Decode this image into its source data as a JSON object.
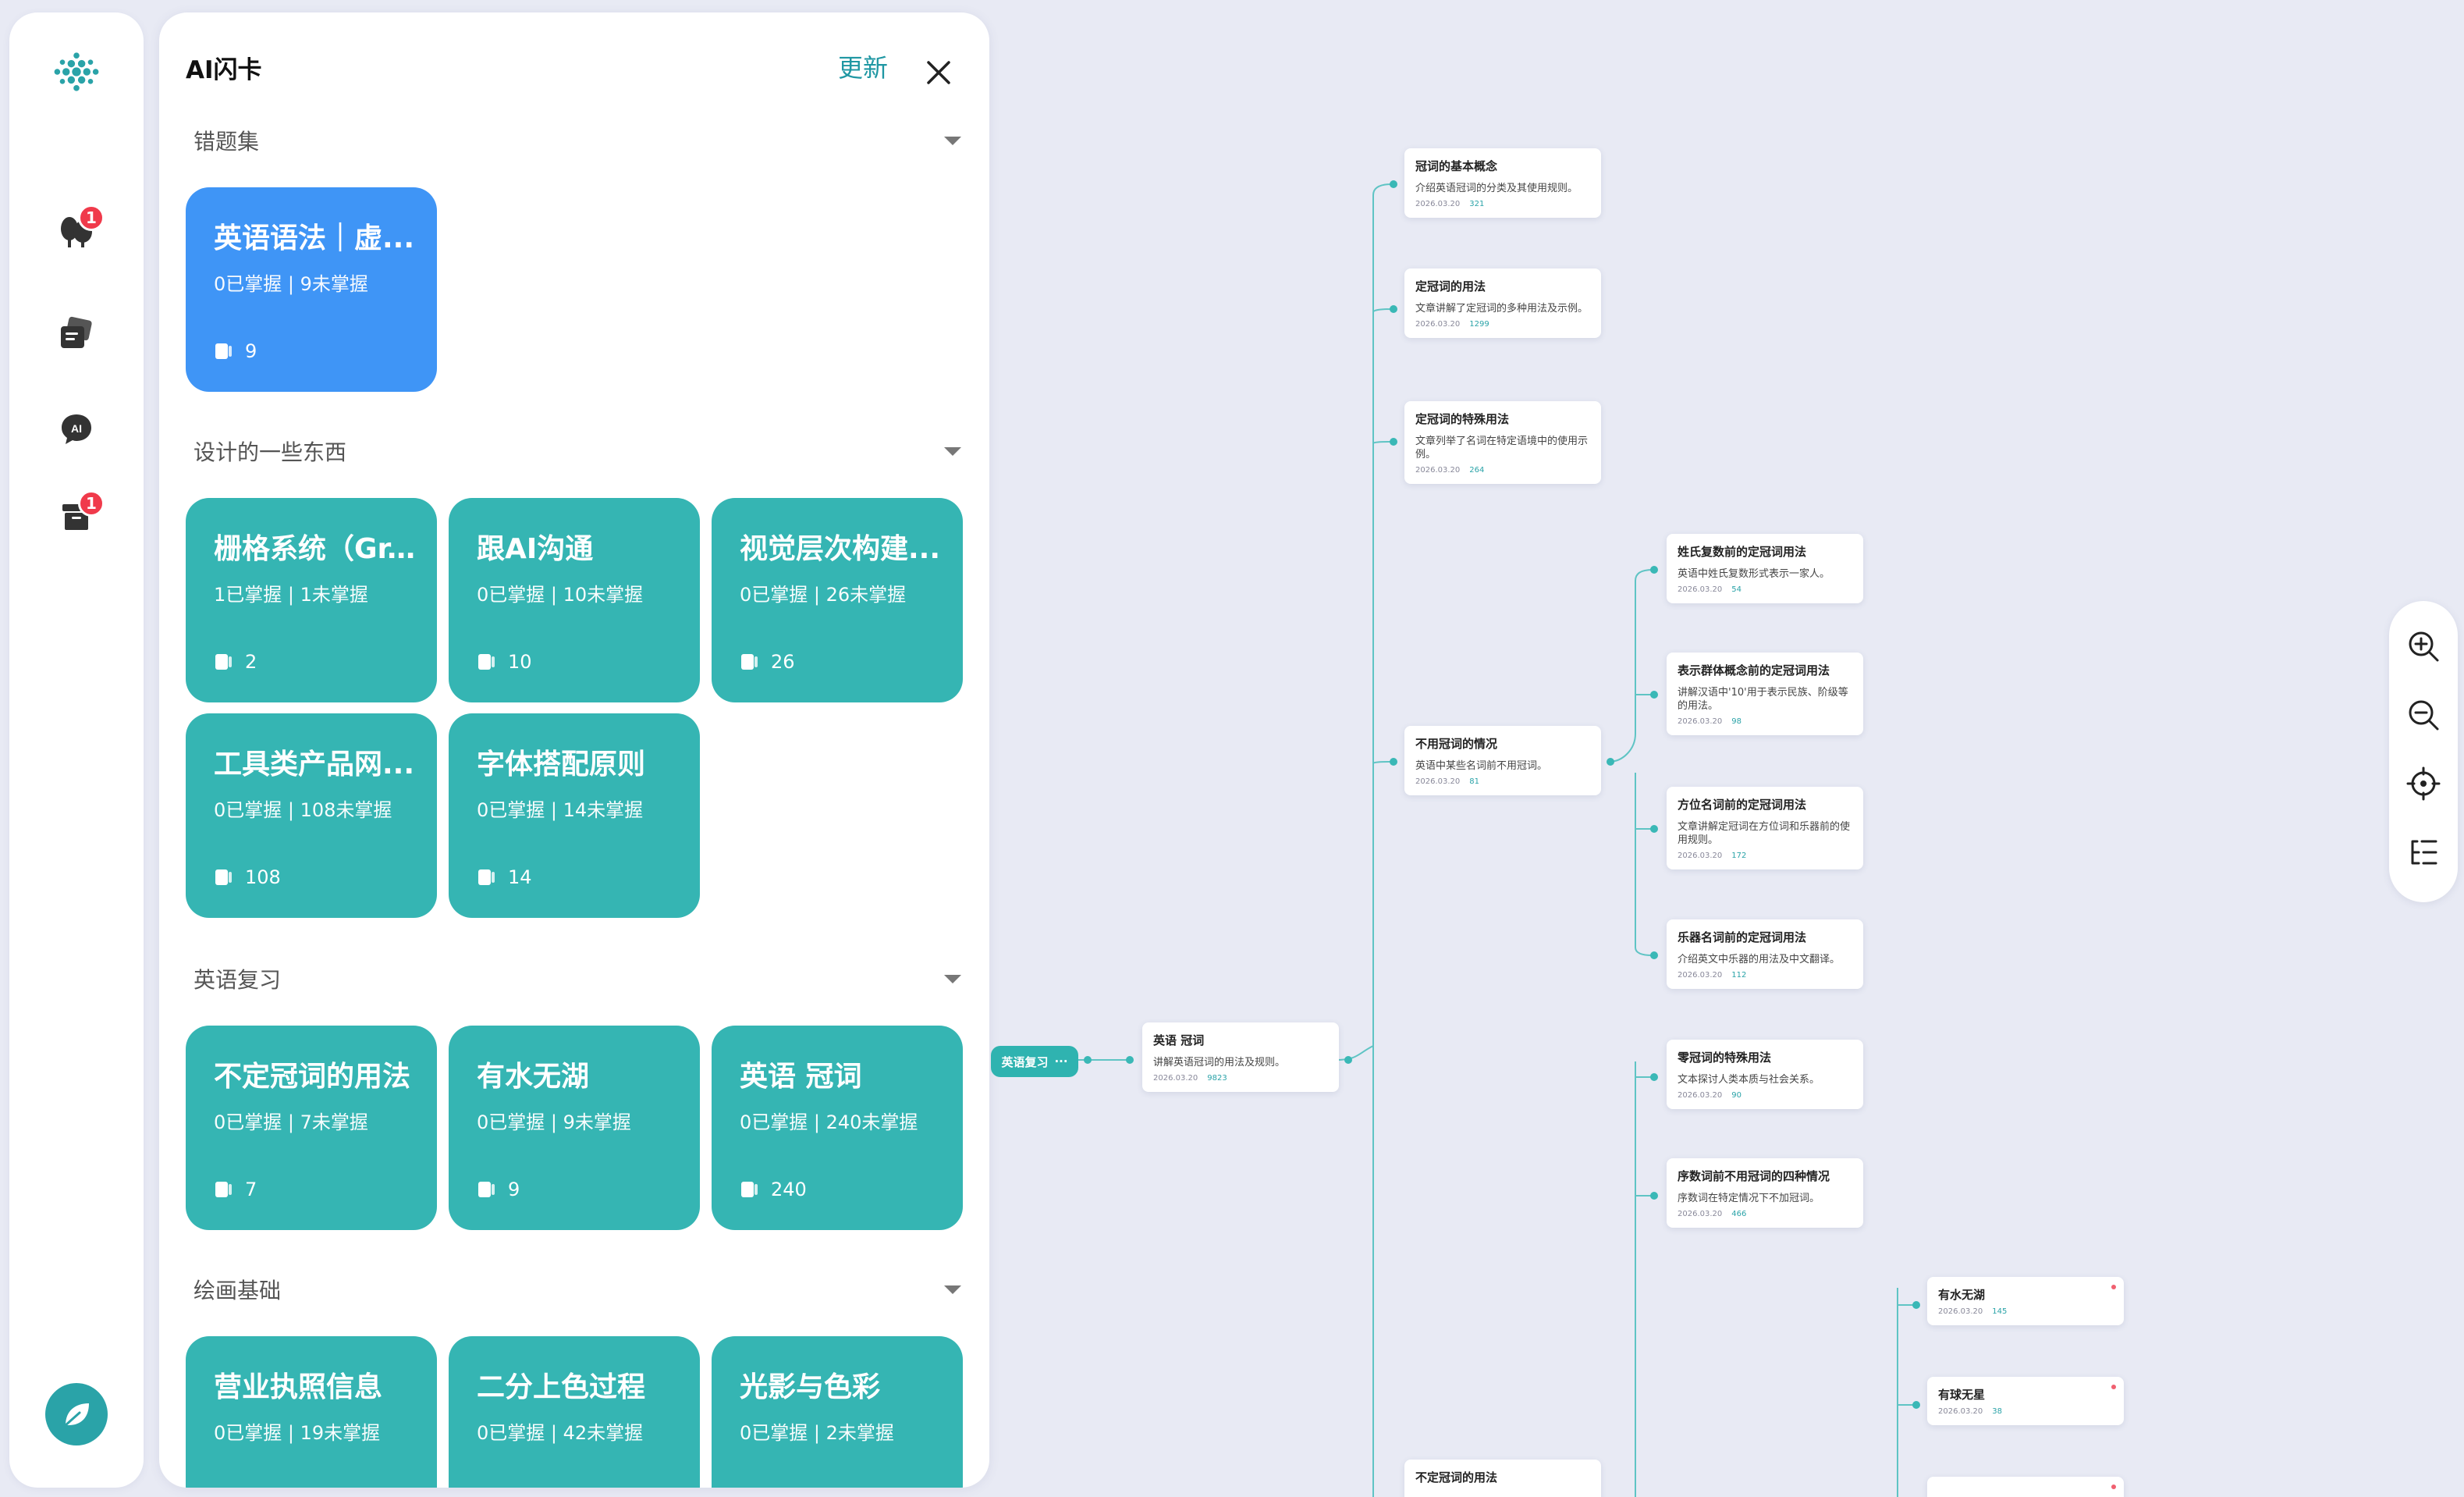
{
  "rail": {
    "badges": {
      "trees": "1",
      "archive": "1"
    }
  },
  "panel": {
    "title": "AI闪卡",
    "refresh_label": "更新",
    "sections": [
      {
        "title": "错题集",
        "cards": [
          {
            "title": "英语语法｜虚...",
            "stats": "0已掌握 | 9未掌握",
            "count": "9",
            "color": "#3f95f6"
          }
        ]
      },
      {
        "title": "设计的一些东西",
        "cards": [
          {
            "title": "栅格系统（Gr...",
            "stats": "1已掌握 | 1未掌握",
            "count": "2"
          },
          {
            "title": "跟AI沟通",
            "stats": "0已掌握 | 10未掌握",
            "count": "10"
          },
          {
            "title": "视觉层次构建...",
            "stats": "0已掌握 | 26未掌握",
            "count": "26"
          },
          {
            "title": "工具类产品网...",
            "stats": "0已掌握 | 108未掌握",
            "count": "108"
          },
          {
            "title": "字体搭配原则",
            "stats": "0已掌握 | 14未掌握",
            "count": "14"
          }
        ]
      },
      {
        "title": "英语复习",
        "cards": [
          {
            "title": "不定冠词的用法",
            "stats": "0已掌握 | 7未掌握",
            "count": "7"
          },
          {
            "title": "有水无湖",
            "stats": "0已掌握 | 9未掌握",
            "count": "9"
          },
          {
            "title": "英语 冠词",
            "stats": "0已掌握 | 240未掌握",
            "count": "240"
          }
        ]
      },
      {
        "title": "绘画基础",
        "cards": [
          {
            "title": "营业执照信息",
            "stats": "0已掌握 | 19未掌握",
            "count": ""
          },
          {
            "title": "二分上色过程",
            "stats": "0已掌握 | 42未掌握",
            "count": ""
          },
          {
            "title": "光影与色彩",
            "stats": "0已掌握 | 2未掌握",
            "count": ""
          }
        ]
      }
    ]
  },
  "mindmap": {
    "root": {
      "label": "英语复习"
    },
    "nodes": [
      {
        "id": "n1",
        "title": "英语 冠词",
        "desc": "讲解英语冠词的用法及规则。",
        "date": "2026.03.20",
        "count": "9823"
      },
      {
        "id": "n2",
        "title": "冠词的基本概念",
        "desc": "介绍英语冠词的分类及其使用规则。",
        "date": "2026.03.20",
        "count": "321"
      },
      {
        "id": "n3",
        "title": "定冠词的用法",
        "desc": "文章讲解了定冠词的多种用法及示例。",
        "date": "2026.03.20",
        "count": "1299"
      },
      {
        "id": "n4",
        "title": "定冠词的特殊用法",
        "desc": "文章列举了名词在特定语境中的使用示例。",
        "date": "2026.03.20",
        "count": "264"
      },
      {
        "id": "n5",
        "title": "不用冠词的情况",
        "desc": "英语中某些名词前不用冠词。",
        "date": "2026.03.20",
        "count": "81"
      },
      {
        "id": "n6",
        "title": "不定冠词的用法",
        "desc": "",
        "date": "",
        "count": ""
      },
      {
        "id": "n7",
        "title": "姓氏复数前的定冠词用法",
        "desc": "英语中姓氏复数形式表示一家人。",
        "date": "2026.03.20",
        "count": "54"
      },
      {
        "id": "n8",
        "title": "表示群体概念前的定冠词用法",
        "desc": "讲解汉语中'10'用于表示民族、阶级等的用法。",
        "date": "2026.03.20",
        "count": "98"
      },
      {
        "id": "n9",
        "title": "方位名词前的定冠词用法",
        "desc": "文章讲解定冠词在方位词和乐器前的使用规则。",
        "date": "2026.03.20",
        "count": "172"
      },
      {
        "id": "n10",
        "title": "乐器名词前的定冠词用法",
        "desc": "介绍英文中乐器的用法及中文翻译。",
        "date": "2026.03.20",
        "count": "112"
      },
      {
        "id": "n11",
        "title": "零冠词的特殊用法",
        "desc": "文本探讨人类本质与社会关系。",
        "date": "2026.03.20",
        "count": "90"
      },
      {
        "id": "n12",
        "title": "序数词前不用冠词的四种情况",
        "desc": "序数词在特定情况下不加冠词。",
        "date": "2026.03.20",
        "count": "466"
      },
      {
        "id": "n13",
        "title": "有水无湖",
        "desc": "",
        "date": "2026.03.20",
        "count": "145"
      },
      {
        "id": "n14",
        "title": "有球无星",
        "desc": "",
        "date": "2026.03.20",
        "count": "38"
      }
    ]
  }
}
